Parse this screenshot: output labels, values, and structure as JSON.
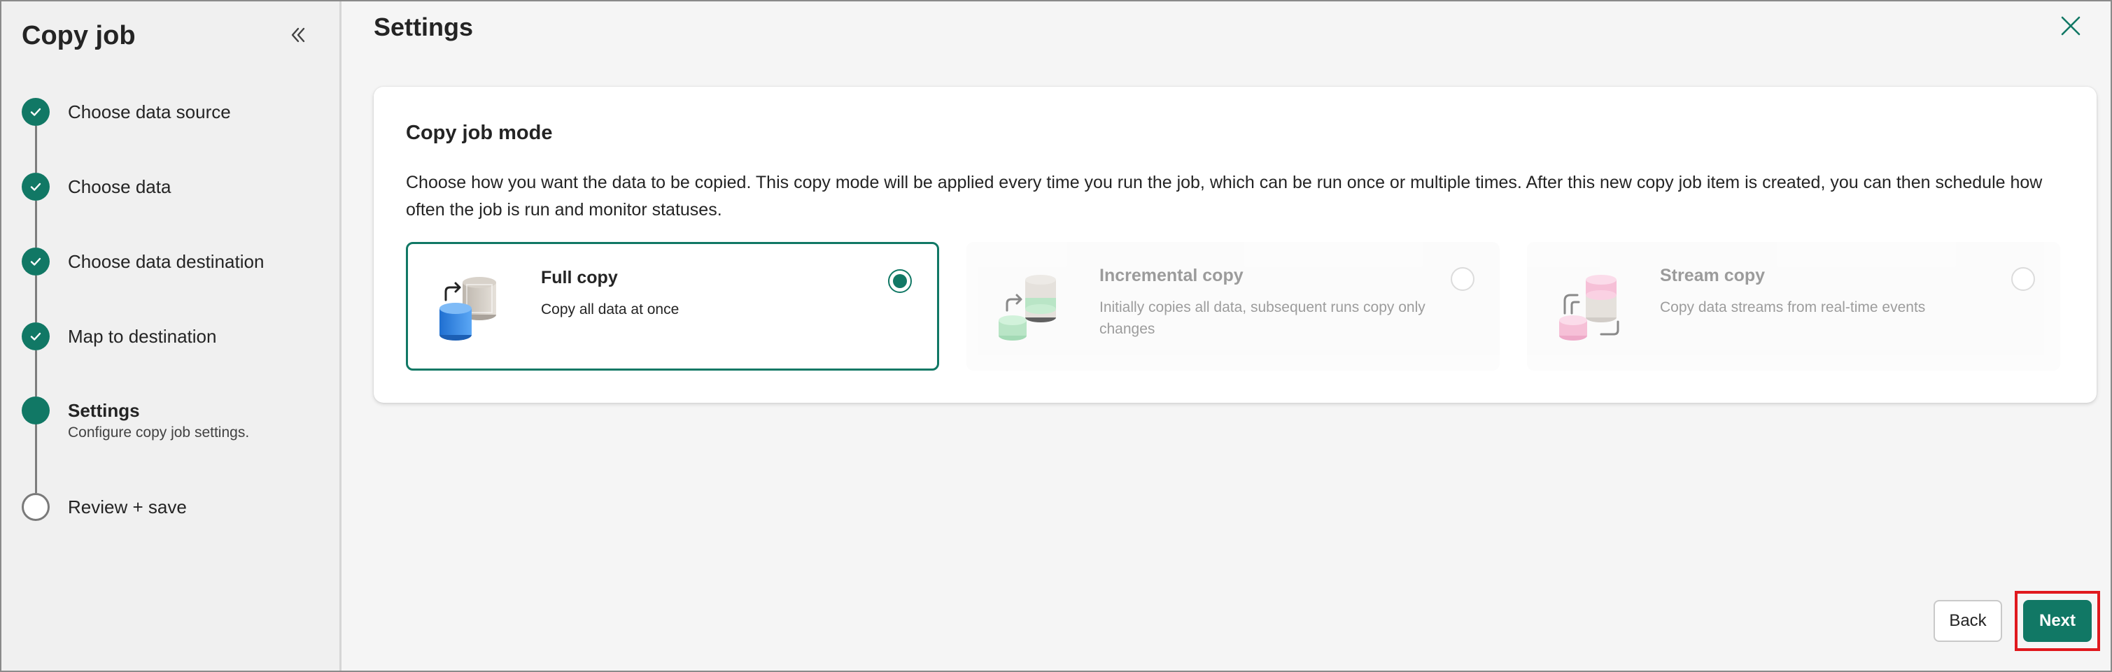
{
  "sidebar": {
    "title": "Copy job",
    "steps": [
      {
        "label": "Choose data source",
        "status": "done"
      },
      {
        "label": "Choose data",
        "status": "done"
      },
      {
        "label": "Choose data destination",
        "status": "done"
      },
      {
        "label": "Map to destination",
        "status": "done"
      },
      {
        "label": "Settings",
        "status": "active",
        "sub": "Configure copy job settings."
      },
      {
        "label": "Review + save",
        "status": "pending"
      }
    ]
  },
  "main": {
    "title": "Settings",
    "card": {
      "title": "Copy job mode",
      "description": "Choose how you want the data to be copied. This copy mode will be applied every time you run the job, which can be run once or multiple times. After this new copy job item is created, you can then schedule how often the job is run and monitor statuses.",
      "options": [
        {
          "title": "Full copy",
          "desc": "Copy all data at once",
          "selected": true,
          "enabled": true,
          "icon": "full-copy-icon"
        },
        {
          "title": "Incremental copy",
          "desc": "Initially copies all data, subsequent runs copy only changes",
          "selected": false,
          "enabled": false,
          "icon": "incremental-copy-icon"
        },
        {
          "title": "Stream copy",
          "desc": "Copy data streams from real-time events",
          "selected": false,
          "enabled": false,
          "icon": "stream-copy-icon"
        }
      ]
    }
  },
  "footer": {
    "back_label": "Back",
    "next_label": "Next"
  },
  "colors": {
    "accent": "#117865",
    "highlight": "#e0191e"
  }
}
